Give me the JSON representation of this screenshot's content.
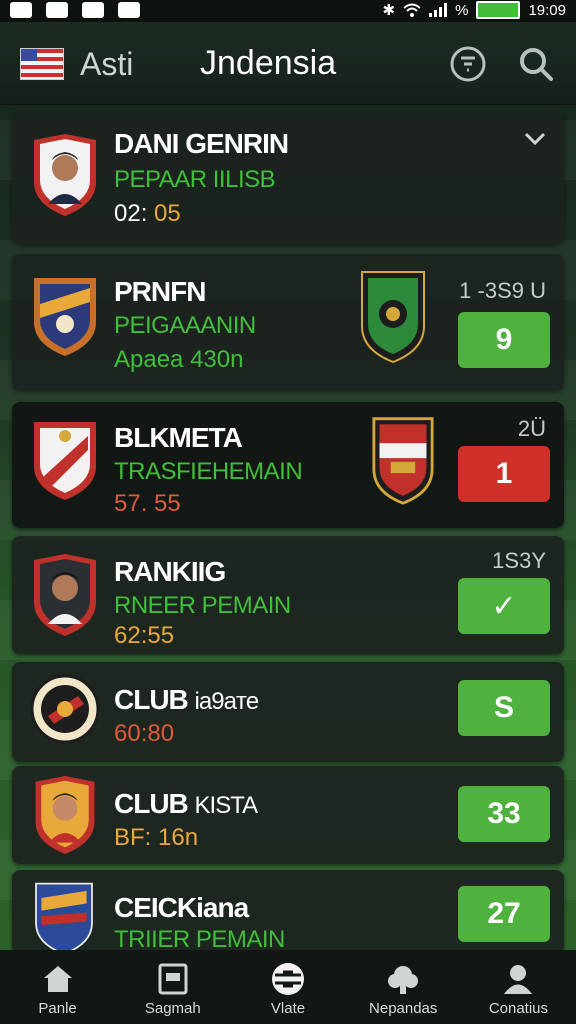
{
  "status": {
    "time": "19:09"
  },
  "header": {
    "left_text": "Asti",
    "title": "Jndensia"
  },
  "cards": [
    {
      "name": "DANI GENRIN",
      "sub": "PEPAAR IILISB",
      "time_a": "02: ",
      "time_b": "05"
    },
    {
      "name": "PRNFN",
      "sub": "PEIGAAANIN",
      "time": "Apaea 430n",
      "label": "1 -3S9 U",
      "score": "9"
    },
    {
      "name": "BLKMETA",
      "sub": "TRASFIEHEMAIN",
      "time": "57. 55",
      "label": "2Ü",
      "score": "1"
    },
    {
      "name": "RANKIIG",
      "sub": "RNEER PEMAIN",
      "time": "62:55",
      "label": "1S3Y",
      "score": "✓"
    },
    {
      "name": "CLUB",
      "name_small": "ia9aтe",
      "time": "60:80",
      "score": "S"
    },
    {
      "name": "CLUB",
      "name_small": "KISTA",
      "time": "BF: 16n",
      "score": "33"
    },
    {
      "name": "CEICKiana",
      "sub": "TRIIER PEMAIN",
      "score": "27"
    }
  ],
  "nav": [
    "Panle",
    "Sagmah",
    "Vlate",
    "Nepandas",
    "Conatius"
  ]
}
